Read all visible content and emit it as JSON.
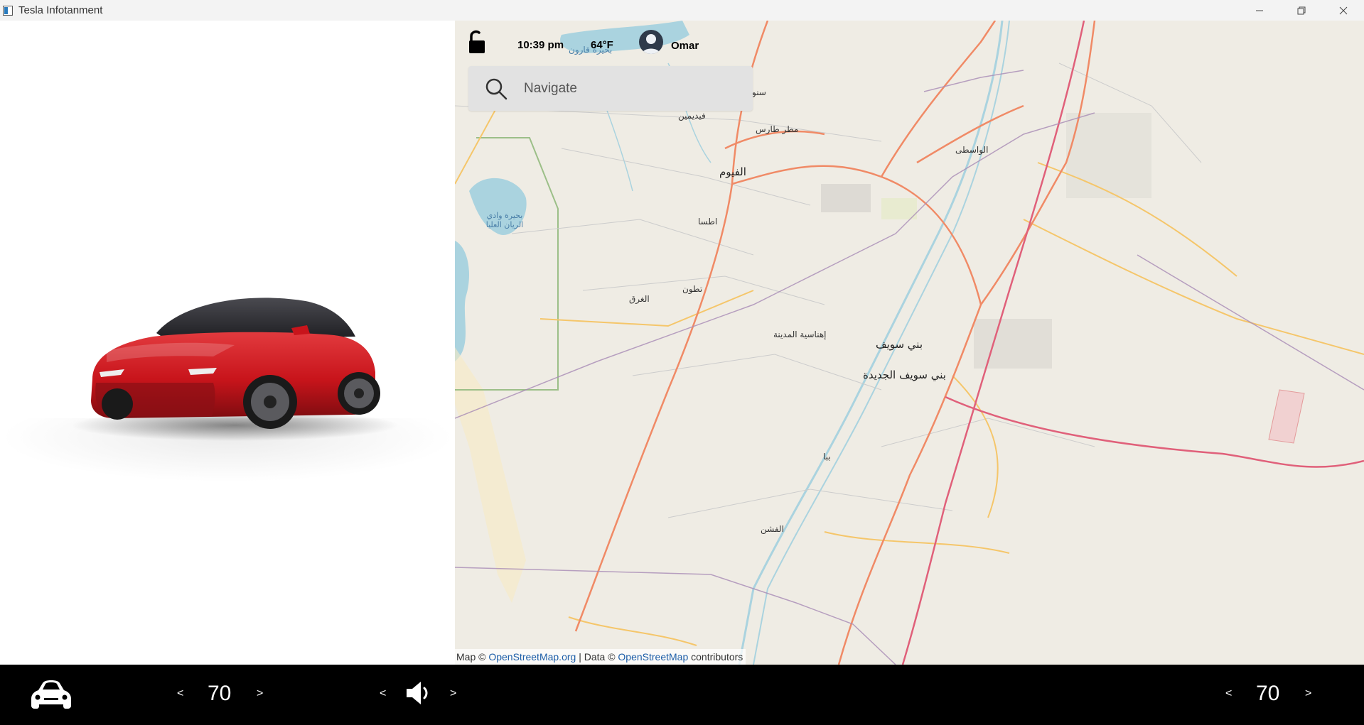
{
  "window": {
    "title": "Tesla Infotanment"
  },
  "status": {
    "time": "10:39 pm",
    "temperature": "64°F",
    "user": "Omar"
  },
  "search": {
    "placeholder": "Navigate"
  },
  "map": {
    "labels": {
      "fayoum": "الفيوم",
      "beni_suef": "بني سويف",
      "new_beni_suef": "بني سويف الجديدة",
      "ehnasia": "إهناسية المدينة",
      "itsa": "اطسا",
      "tatoun": "تطون",
      "gharaq": "الغرق",
      "wasta": "الواسطى",
      "tamiya_airport": "مطر طارس",
      "fidimin": "فيديمين",
      "sinuris": "سنو",
      "wadi_rayan": "بحيرة وادي الريان العليا",
      "qarun": "بحيرة قارون",
      "bana": "ببا",
      "fashn": "الفشن"
    },
    "attribution": {
      "prefix": "Map ©",
      "osm_link": "OpenStreetMap.org",
      "middle": "| Data ©",
      "osm_data_link": "OpenStreetMap",
      "suffix": "contributors"
    }
  },
  "bottom_bar": {
    "left_temp": {
      "decrease": "<",
      "value": "70",
      "increase": ">"
    },
    "volume": {
      "decrease": "<",
      "increase": ">"
    },
    "right_temp": {
      "decrease": "<",
      "value": "70",
      "increase": ">"
    }
  },
  "colors": {
    "car_red": "#c8141b",
    "map_bg": "#efece4",
    "primary_road": "#f08a66",
    "trunk_road": "#e0607a",
    "secondary_road": "#f5c66a",
    "water": "#aad3df",
    "boundary": "#a88bb5",
    "bottom_bar": "#000000"
  }
}
